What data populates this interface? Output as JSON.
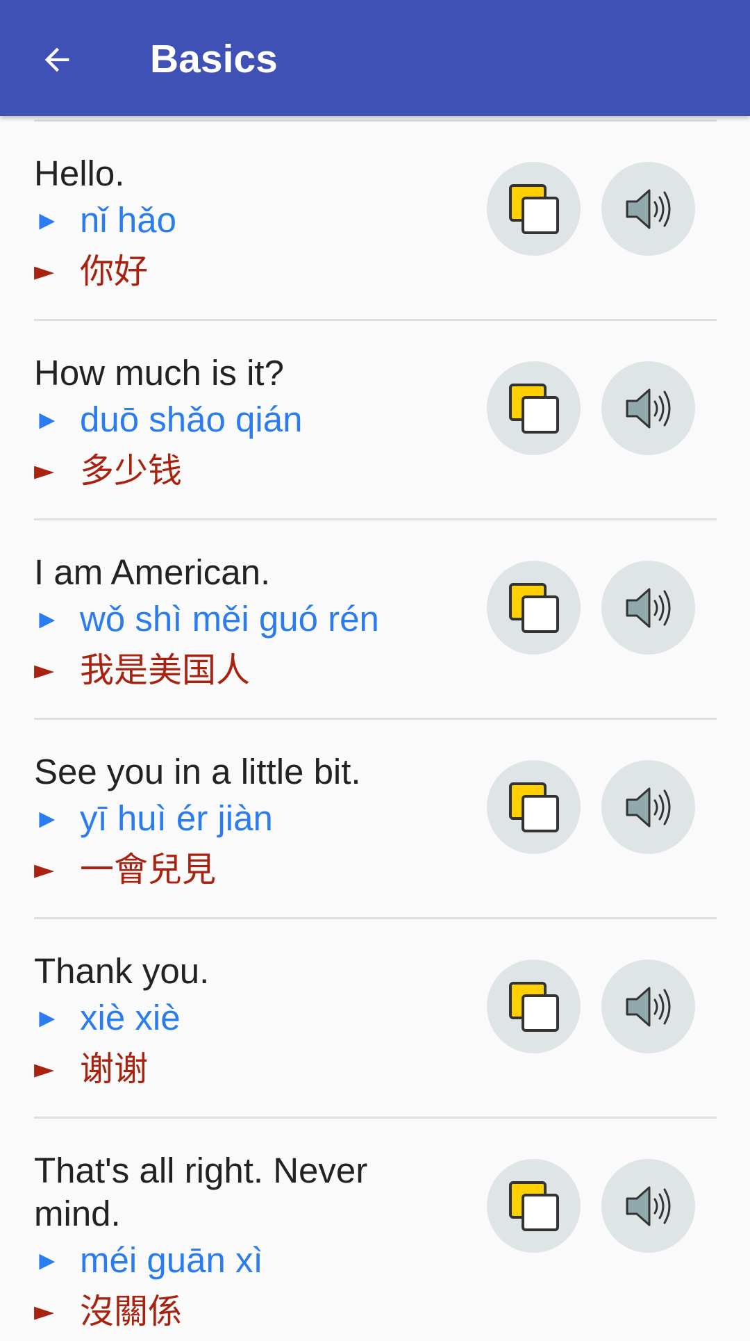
{
  "header": {
    "title": "Basics",
    "back_icon": "arrow-back-icon",
    "background_color": "#3f51b5"
  },
  "colors": {
    "pinyin": "#2a7cf0",
    "hanzi": "#a8220f",
    "english": "#222222",
    "button_bg": "#dfe4e6",
    "copy_front": "#ffffff",
    "copy_back": "#ffd000"
  },
  "marker": "►",
  "icons": {
    "copy": "copy-icon",
    "speak": "speaker-icon"
  },
  "phrases": [
    {
      "english": "Hello.",
      "pinyin": "nǐ hǎo",
      "hanzi": "你好"
    },
    {
      "english": "How much is it?",
      "pinyin": "duō shǎo qián",
      "hanzi": "多少钱"
    },
    {
      "english": "I am American.",
      "pinyin": "wǒ shì měi guó rén",
      "hanzi": "我是美国人"
    },
    {
      "english": "See you in a little bit.",
      "pinyin": "yī huì ér jiàn",
      "hanzi": "一會兒見"
    },
    {
      "english": "Thank you.",
      "pinyin": "xiè xiè",
      "hanzi": "谢谢"
    },
    {
      "english": "That's all right. Never mind.",
      "pinyin": "méi guān xì",
      "hanzi": "沒關係"
    }
  ]
}
